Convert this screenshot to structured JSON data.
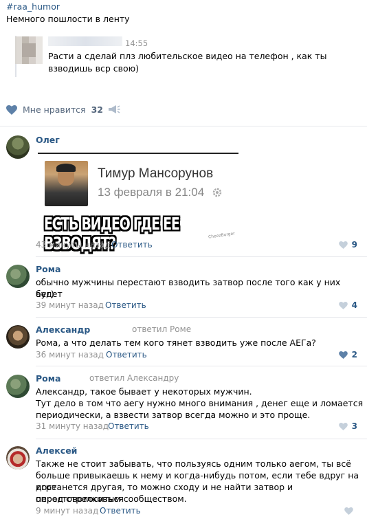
{
  "post": {
    "tag": "#raa_humor",
    "text": "Немного пошлости в ленту",
    "quoted": {
      "time": "14:55",
      "text_line1": "Расти а сделай плз любительское видео на телефон , как ты",
      "text_line2": "взводишь вср свою)"
    },
    "likes_label": "Мне нравится",
    "likes_count": "32"
  },
  "comments": [
    {
      "author": "Олег",
      "image": {
        "name": "Тимур Мансорунов",
        "date": "13 февраля в 21:04",
        "caption": "ЕСТЬ ВИДЕО ГДЕ ЕЕ ВЗВОДЯТ?",
        "watermark": "CheezBurger"
      },
      "time": "43 минуты назад",
      "reply": "Ответить",
      "likes": "9"
    },
    {
      "author": "Рома",
      "line1": "обычно мужчины перестают взводить затвор после того как у них будет",
      "line2": "аег)",
      "time": "39 минут назад",
      "reply": "Ответить",
      "likes": "4"
    },
    {
      "author": "Александр",
      "replied_to": "ответил Роме",
      "line1": "Рома, а что делать тем кого тянет взводить уже после АЕГа?",
      "time": "36 минут назад",
      "reply": "Ответить",
      "likes": "2"
    },
    {
      "author": "Рома",
      "replied_to": "ответил Александру",
      "line1": "Александр, такое бывает у некоторых мужчин.",
      "line2": "Тут дело в том что аегу нужно много внимания , денег еще и ломается",
      "line3": "периодически, а взвести затвор всегда можно и это проще.",
      "time": "31 минуту назад",
      "reply": "Ответить",
      "likes": "3"
    },
    {
      "author": "Алексей",
      "line1": "Также не стоит забывать, что пользуясь одним только аегом, ты всё",
      "line2": "больше привыкаешь к нему и когда-нибудь потом, если тебе вдруг на игре",
      "line3": "достанется другая, то можно сходу и не найти затвор и опростоволоситься",
      "line4": "перед стрелковым сообществом.",
      "time": "9 минут назад",
      "reply": "Ответить"
    }
  ]
}
